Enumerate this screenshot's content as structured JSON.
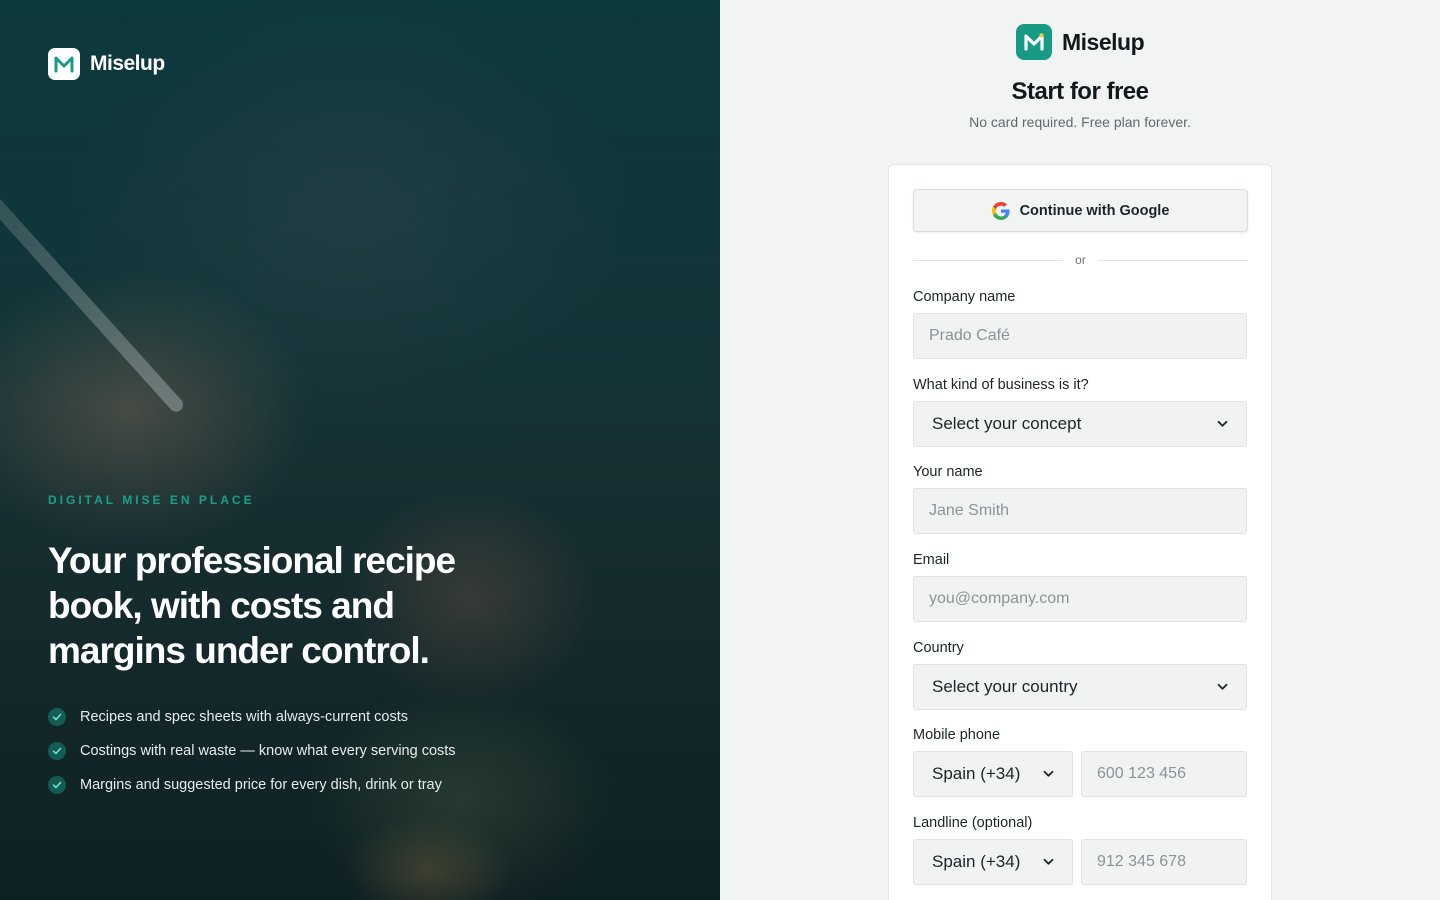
{
  "hero": {
    "brand": "Miselup",
    "eyebrow": "DIGITAL MISE EN PLACE",
    "headline": "Your professional recipe book, with costs and margins under control.",
    "features": [
      "Recipes and spec sheets with always-current costs",
      "Costings with real waste — know what every serving costs",
      "Margins and suggested price for every dish, drink or tray"
    ]
  },
  "form": {
    "brand": "Miselup",
    "title": "Start for free",
    "subtitle": "No card required. Free plan forever.",
    "google_label": "Continue with Google",
    "divider": "or",
    "company": {
      "label": "Company name",
      "placeholder": "Prado Café"
    },
    "business": {
      "label": "What kind of business is it?",
      "value": "Select your concept"
    },
    "name": {
      "label": "Your name",
      "placeholder": "Jane Smith"
    },
    "email": {
      "label": "Email",
      "placeholder": "you@company.com"
    },
    "country": {
      "label": "Country",
      "value": "Select your country"
    },
    "mobile": {
      "label": "Mobile phone",
      "prefix": "Spain (+34)",
      "placeholder": "600 123 456"
    },
    "landline": {
      "label": "Landline (optional)",
      "prefix": "Spain (+34)",
      "placeholder": "912 345 678"
    }
  },
  "colors": {
    "accent": "#179a86",
    "hero_dark": "#0f3b3d",
    "panel_bg": "#f2f4f4"
  },
  "icons": [
    "miselup-logo-icon",
    "check-icon",
    "google-icon",
    "chevron-down-icon"
  ]
}
